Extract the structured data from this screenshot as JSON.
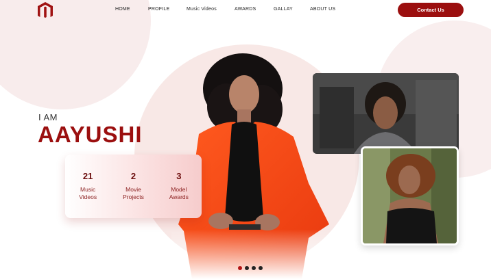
{
  "brand": {
    "logo_icon": "magento-m-logo-icon",
    "accent": "#9b0f0f"
  },
  "nav": {
    "items": [
      {
        "label": "HOME"
      },
      {
        "label": "PROFILE"
      },
      {
        "label": "Music Videos"
      },
      {
        "label": "AWARDS"
      },
      {
        "label": "GALLAY"
      },
      {
        "label": "ABOUT US"
      }
    ],
    "contact_label": "Contact Us"
  },
  "hero": {
    "intro": "I AM",
    "name": "AAYUSHI"
  },
  "stats": [
    {
      "number": "21",
      "label_line1": "Music",
      "label_line2": "Videos"
    },
    {
      "number": "2",
      "label_line1": "Movie",
      "label_line2": "Projects"
    },
    {
      "number": "3",
      "label_line1": "Model",
      "label_line2": "Awards"
    }
  ],
  "carousel": {
    "dots": 4,
    "active_index": 0
  }
}
